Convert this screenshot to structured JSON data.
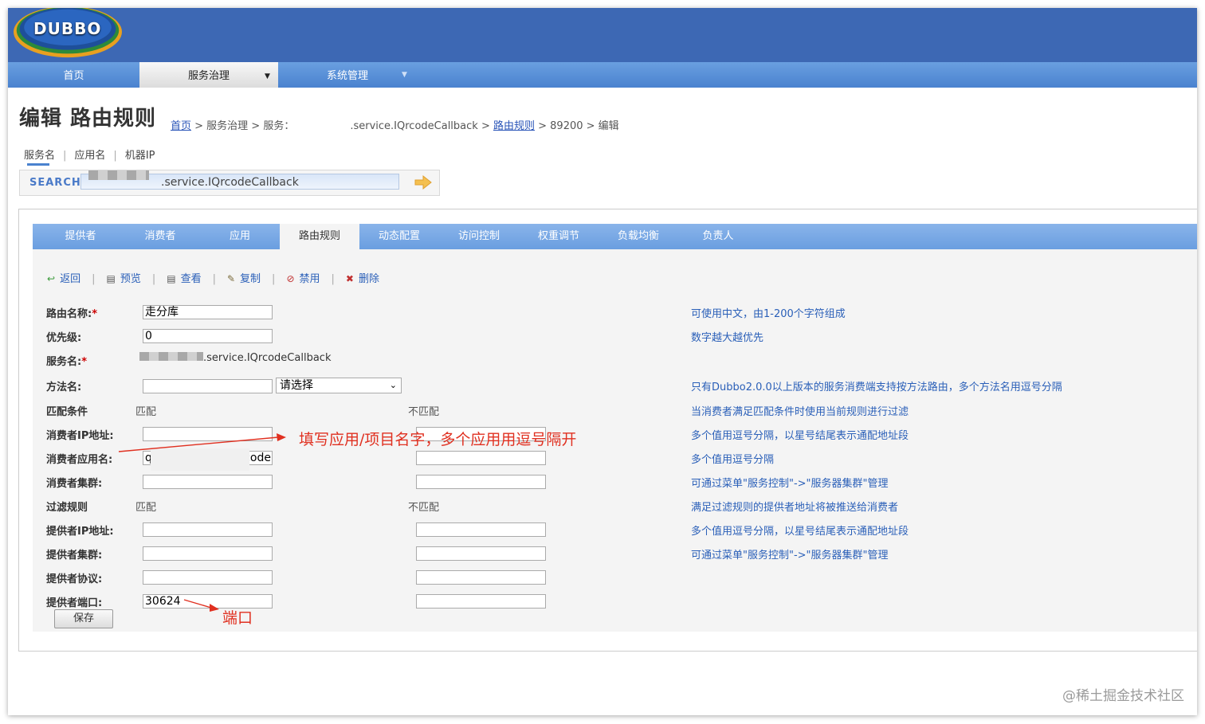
{
  "logo": {
    "text": "DUBBO"
  },
  "nav": {
    "home": "首页",
    "service_gov": "服务治理",
    "system_mgmt": "系统管理",
    "dropdown_glyph": "▼"
  },
  "page": {
    "title": "编辑 路由规则"
  },
  "breadcrumb": {
    "home": "首页",
    "sep1": " > 服务治理 > 服务：",
    "service": ".service.IQrcodeCallback",
    "sep2": " > ",
    "route_rules": "路由规则",
    "tail": " > 89200 > 编辑"
  },
  "search": {
    "tab_service": "服务名",
    "tab_app": "应用名",
    "tab_ip": "机器IP",
    "label": "SEARCH",
    "value": ".service.IQrcodeCallback"
  },
  "tabs": [
    "提供者",
    "消费者",
    "应用",
    "路由规则",
    "动态配置",
    "访问控制",
    "权重调节",
    "负载均衡",
    "负责人"
  ],
  "toolbar": {
    "back": "返回",
    "preview": "预览",
    "view": "查看",
    "copy": "复制",
    "disable": "禁用",
    "delete": "删除"
  },
  "form": {
    "route_name_label": "路由名称:",
    "route_name_value": "走分库",
    "priority_label": "优先级:",
    "priority_value": "0",
    "service_label": "服务名:",
    "service_value": ".service.IQrcodeCallback",
    "method_label": "方法名:",
    "method_select": "请选择",
    "match_cond_label": "匹配条件",
    "match": "匹配",
    "nomatch": "不匹配",
    "consumer_ip_label": "消费者IP地址:",
    "consumer_app_label": "消费者应用名:",
    "consumer_app_value_start": "q",
    "consumer_app_value_end": "code",
    "consumer_cluster_label": "消费者集群:",
    "filter_rule_label": "过滤规则",
    "provider_ip_label": "提供者IP地址:",
    "provider_cluster_label": "提供者集群:",
    "provider_protocol_label": "提供者协议:",
    "provider_port_label": "提供者端口:",
    "provider_port_value": "30624",
    "required_mark": "*",
    "save": "保存"
  },
  "hints": {
    "route_name": "可使用中文，由1-200个字符组成",
    "priority": "数字越大越优先",
    "method": "只有Dubbo2.0.0以上版本的服务消费端支持按方法路由，多个方法名用逗号分隔",
    "match_cond": "当消费者满足匹配条件时使用当前规则进行过滤",
    "consumer_ip": "多个值用逗号分隔，以星号结尾表示通配地址段",
    "consumer_app": "多个值用逗号分隔",
    "consumer_cluster": "可通过菜单\"服务控制\"->\"服务器集群\"管理",
    "filter_rule": "满足过滤规则的提供者地址将被推送给消费者",
    "provider_ip": "多个值用逗号分隔，以星号结尾表示通配地址段",
    "provider_cluster": "可通过菜单\"服务控制\"->\"服务器集群\"管理"
  },
  "annotations": {
    "app_note": "填写应用/项目名字，多个应用用逗号隔开",
    "port_note": "端口",
    "color": "#e03020"
  },
  "watermark": "@稀土掘金技术社区",
  "colors": {
    "header": "#3d68b4",
    "link": "#2a5fb8",
    "annotation": "#e03020"
  }
}
